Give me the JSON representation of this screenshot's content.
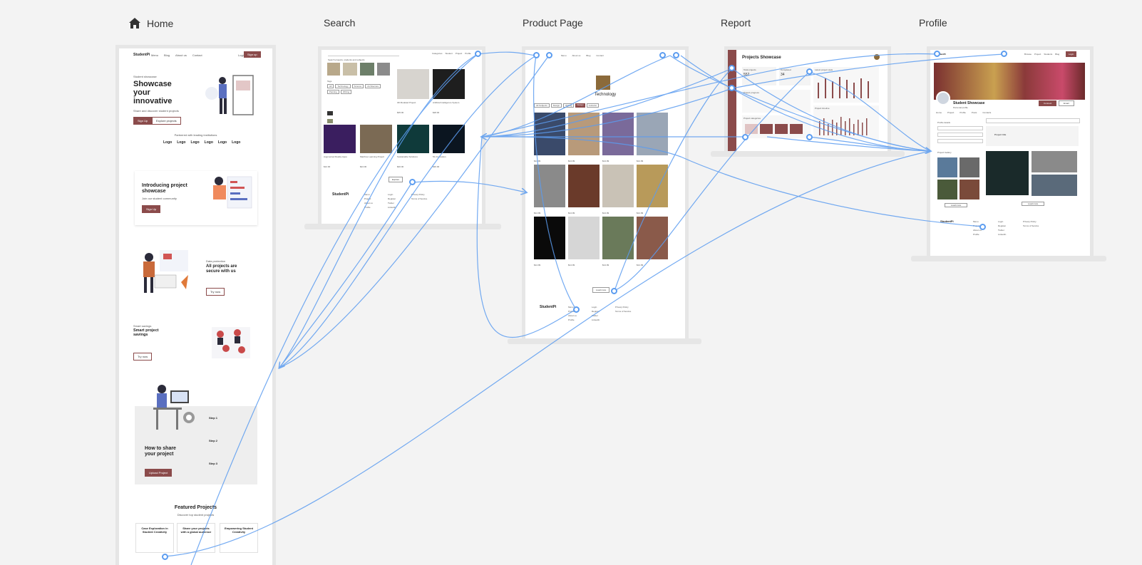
{
  "frames": {
    "home": {
      "label": "Home"
    },
    "search": {
      "label": "Search"
    },
    "product": {
      "label": "Product Page"
    },
    "report": {
      "label": "Report"
    },
    "profile": {
      "label": "Profile"
    }
  },
  "home_page": {
    "brand": "StudentPi",
    "nav": [
      "Menu",
      "Blog",
      "About us",
      "Contact"
    ],
    "login": "Login",
    "signup": "Sign up",
    "eyebrow": "Student showcase",
    "hero_title_1": "Showcase",
    "hero_title_2": "your",
    "hero_title_3": "innovative",
    "hero_desc": "Share and discover student projects",
    "hero_btn_primary": "Sign Up",
    "hero_btn_secondary": "Explore projects",
    "partners_caption": "Partnered with leading institutions",
    "logos": [
      "Logo",
      "Logo",
      "Logo",
      "Logo",
      "Logo",
      "Logo"
    ],
    "section1_title_1": "Introducing project",
    "section1_title_2": "showcase",
    "section1_desc": "Join our student community",
    "section1_btn": "Sign Up",
    "section2_eyebrow": "Data protection",
    "section2_title_1": "All projects are",
    "section2_title_2": "secure with us",
    "section2_btn": "Try now",
    "section3_eyebrow": "Smart savings",
    "section3_title_1": "Smart project",
    "section3_title_2": "savings",
    "section3_btn": "Try now",
    "steps_title_1": "How to share",
    "steps_title_2": "your project",
    "steps_btn": "Upload Project",
    "steps": [
      "Step 1",
      "Step 2",
      "Step 3"
    ],
    "featured_title": "Featured Projects",
    "featured_sub": "Discover top student projects",
    "featured_cards": [
      "Case Exploration in Student Creativity",
      "Share your projects with a global audience",
      "Empowering Student Creativity"
    ]
  },
  "search_page": {
    "search_placeholder": "Search projects, students and subjects",
    "nav": [
      "Categories",
      "Student",
      "Project",
      "Profile"
    ],
    "tags_label": "Tags",
    "tags": [
      "All",
      "Technology",
      "Science",
      "Architecture",
      "Painting",
      "Writing"
    ],
    "cards": [
      {
        "title": "3D Modeled Project",
        "price": "$35.00"
      },
      {
        "title": "Artificial Intelligence System",
        "price": "$28.00"
      },
      {
        "title": "Augmented Reality Apps",
        "price": "$12.00"
      },
      {
        "title": "Machine Learning Project",
        "price": "$24.00"
      },
      {
        "title": "Sustainable Solutions",
        "price": "$40.00"
      },
      {
        "title": "5G Innovation",
        "price": "$30.00"
      }
    ],
    "explore_btn": "Explore",
    "footer_brand": "StudentPi",
    "footer_cols": [
      [
        "Menu",
        "Project",
        "About us",
        "Profile"
      ],
      [
        "Login",
        "Register",
        "Twitter",
        "LinkedIn"
      ],
      [
        "Privacy Policy",
        "Terms of Service"
      ]
    ]
  },
  "product_page": {
    "nav": [
      "Menu",
      "About us",
      "Blog",
      "Contact"
    ],
    "category_title": "Technology",
    "filters": [
      "All Subjects",
      "Design",
      "Writing",
      "Design",
      "Guitarist"
    ],
    "more_btn": "Load more",
    "item_price": "$14.99",
    "footer_brand": "StudentPi",
    "footer_cols": [
      [
        "Menu",
        "Project",
        "About us",
        "Profile"
      ],
      [
        "Login",
        "Register",
        "Twitter",
        "LinkedIn"
      ],
      [
        "Privacy Policy",
        "Terms of Service"
      ]
    ]
  },
  "report_page": {
    "title": "Projects Showcase",
    "stat_1_label": "Total projects",
    "stat_1_value": "552",
    "stat_2_label": "Completed",
    "stat_2_value": "34",
    "panel_1": "Latest project stats",
    "panel_2": "Project progress",
    "panel_3": "Project categories",
    "panel_4": "Project timeline"
  },
  "profile_page": {
    "brand": "StudentPi",
    "nav": [
      "Browse",
      "Project",
      "Students",
      "Blog"
    ],
    "login": "Login",
    "name": "Student Showcase",
    "subtitle": "Personal profile",
    "follow_btn": "Connect",
    "message_btn": "Email",
    "tabs": [
      "Home",
      "Project",
      "Profile",
      "Posts",
      "Contacts"
    ],
    "intro_label": "Profile details",
    "projects_label": "Project Gallery",
    "post_label": "Project title",
    "post_input_placeholder": "Share details of your project",
    "load_more": "Load more",
    "footer_cols": [
      [
        "Menu",
        "Project",
        "About us",
        "Profile"
      ],
      [
        "Login",
        "Register",
        "Twitter",
        "LinkedIn"
      ],
      [
        "Privacy Policy",
        "Terms of Service"
      ]
    ]
  },
  "colors": {
    "accent": "#8b4b4b",
    "wire": "#5b9cf0",
    "canvas": "#f3f3f3"
  }
}
